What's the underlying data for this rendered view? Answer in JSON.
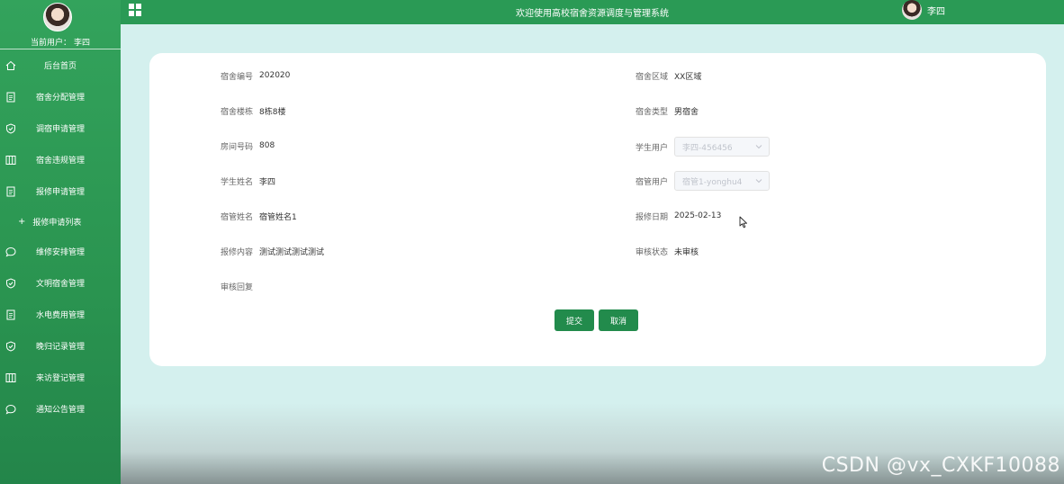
{
  "sidebar": {
    "current_user_label": "当前用户：",
    "current_user_name": "李四",
    "items": [
      {
        "label": "后台首页",
        "icon": "home-icon"
      },
      {
        "label": "宿舍分配管理",
        "icon": "document-icon"
      },
      {
        "label": "调宿申请管理",
        "icon": "shield-check-icon"
      },
      {
        "label": "宿舍违规管理",
        "icon": "columns-icon"
      },
      {
        "label": "报修申请管理",
        "icon": "document-icon"
      },
      {
        "label": "维修安排管理",
        "icon": "chat-icon"
      },
      {
        "label": "文明宿舍管理",
        "icon": "shield-check-icon"
      },
      {
        "label": "水电费用管理",
        "icon": "document-icon"
      },
      {
        "label": "晚归记录管理",
        "icon": "shield-check-icon"
      },
      {
        "label": "来访登记管理",
        "icon": "columns-icon"
      },
      {
        "label": "通知公告管理",
        "icon": "chat-icon"
      }
    ],
    "submenu": {
      "label": "报修申请列表"
    }
  },
  "header": {
    "title": "欢迎使用高校宿舍资源调度与管理系统",
    "username": "李四"
  },
  "form": {
    "dorm_no": {
      "label": "宿舍编号",
      "value": "202020"
    },
    "dorm_area": {
      "label": "宿舍区域",
      "value": "XX区域"
    },
    "dorm_building": {
      "label": "宿舍楼栋",
      "value": "8栋8楼"
    },
    "dorm_type": {
      "label": "宿舍类型",
      "value": "男宿舍"
    },
    "room_no": {
      "label": "房间号码",
      "value": "808"
    },
    "student_user": {
      "label": "学生用户",
      "value": "李四-456456"
    },
    "student_name": {
      "label": "学生姓名",
      "value": "李四"
    },
    "manager_user": {
      "label": "宿管用户",
      "value": "宿管1-yonghu4"
    },
    "manager_name": {
      "label": "宿管姓名",
      "value": "宿管姓名1"
    },
    "repair_date": {
      "label": "报修日期",
      "value": "2025-02-13"
    },
    "repair_content": {
      "label": "报修内容",
      "value": "测试测试测试测试"
    },
    "audit_status": {
      "label": "审核状态",
      "value": "未审核"
    },
    "audit_reply": {
      "label": "审核回复",
      "value": ""
    }
  },
  "buttons": {
    "submit": "提交",
    "cancel": "取消"
  },
  "watermark": "CSDN @vx_CXKF10088",
  "colors": {
    "sidebar": "#2a9450",
    "header": "#2a9a55",
    "button": "#228b4c",
    "background": "#d4f0ee"
  }
}
